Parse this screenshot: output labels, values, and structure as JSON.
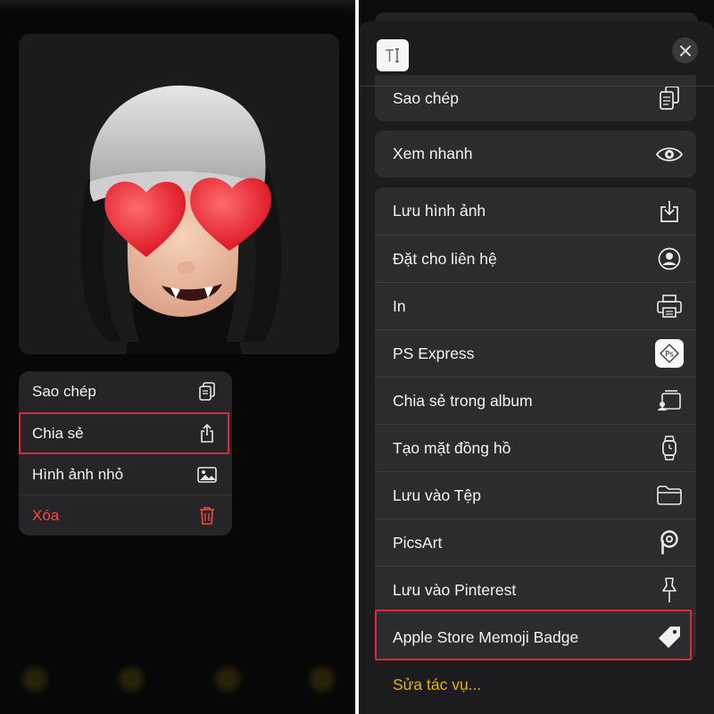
{
  "left_panel": {
    "menu": {
      "items": [
        {
          "label": "Sao chép",
          "icon": "copy-icon"
        },
        {
          "label": "Chia sẻ",
          "icon": "share-icon"
        },
        {
          "label": "Hình ảnh nhỏ",
          "icon": "photo-icon"
        },
        {
          "label": "Xóa",
          "icon": "trash-icon"
        }
      ]
    }
  },
  "right_panel": {
    "header": {
      "text_icon": "text-insert-icon",
      "close_icon": "close-icon"
    },
    "groups": [
      {
        "items": [
          {
            "label": "Sao chép",
            "icon": "copy-icon"
          }
        ]
      },
      {
        "items": [
          {
            "label": "Xem nhanh",
            "icon": "eye-icon"
          }
        ]
      },
      {
        "items": [
          {
            "label": "Lưu hình ảnh",
            "icon": "save-image-icon"
          },
          {
            "label": "Đặt cho liên hệ",
            "icon": "contact-icon"
          },
          {
            "label": "In",
            "icon": "printer-icon"
          },
          {
            "label": "PS Express",
            "icon": "ps-express-icon"
          },
          {
            "label": "Chia sẻ trong album",
            "icon": "shared-album-icon"
          },
          {
            "label": "Tạo mặt đồng hồ",
            "icon": "watch-icon"
          },
          {
            "label": "Lưu vào Tệp",
            "icon": "folder-icon"
          },
          {
            "label": "PicsArt",
            "icon": "picsart-icon"
          },
          {
            "label": "Lưu vào Pinterest",
            "icon": "pin-icon"
          },
          {
            "label": "Apple Store Memoji Badge",
            "icon": "tag-icon"
          }
        ]
      }
    ],
    "edit_actions": "Sửa tác vụ...",
    "ps_badge_text": "Ps"
  },
  "colors": {
    "accent_yellow": "#e5b20f",
    "danger_red": "#ff453a",
    "highlight_red": "#e0283c"
  }
}
